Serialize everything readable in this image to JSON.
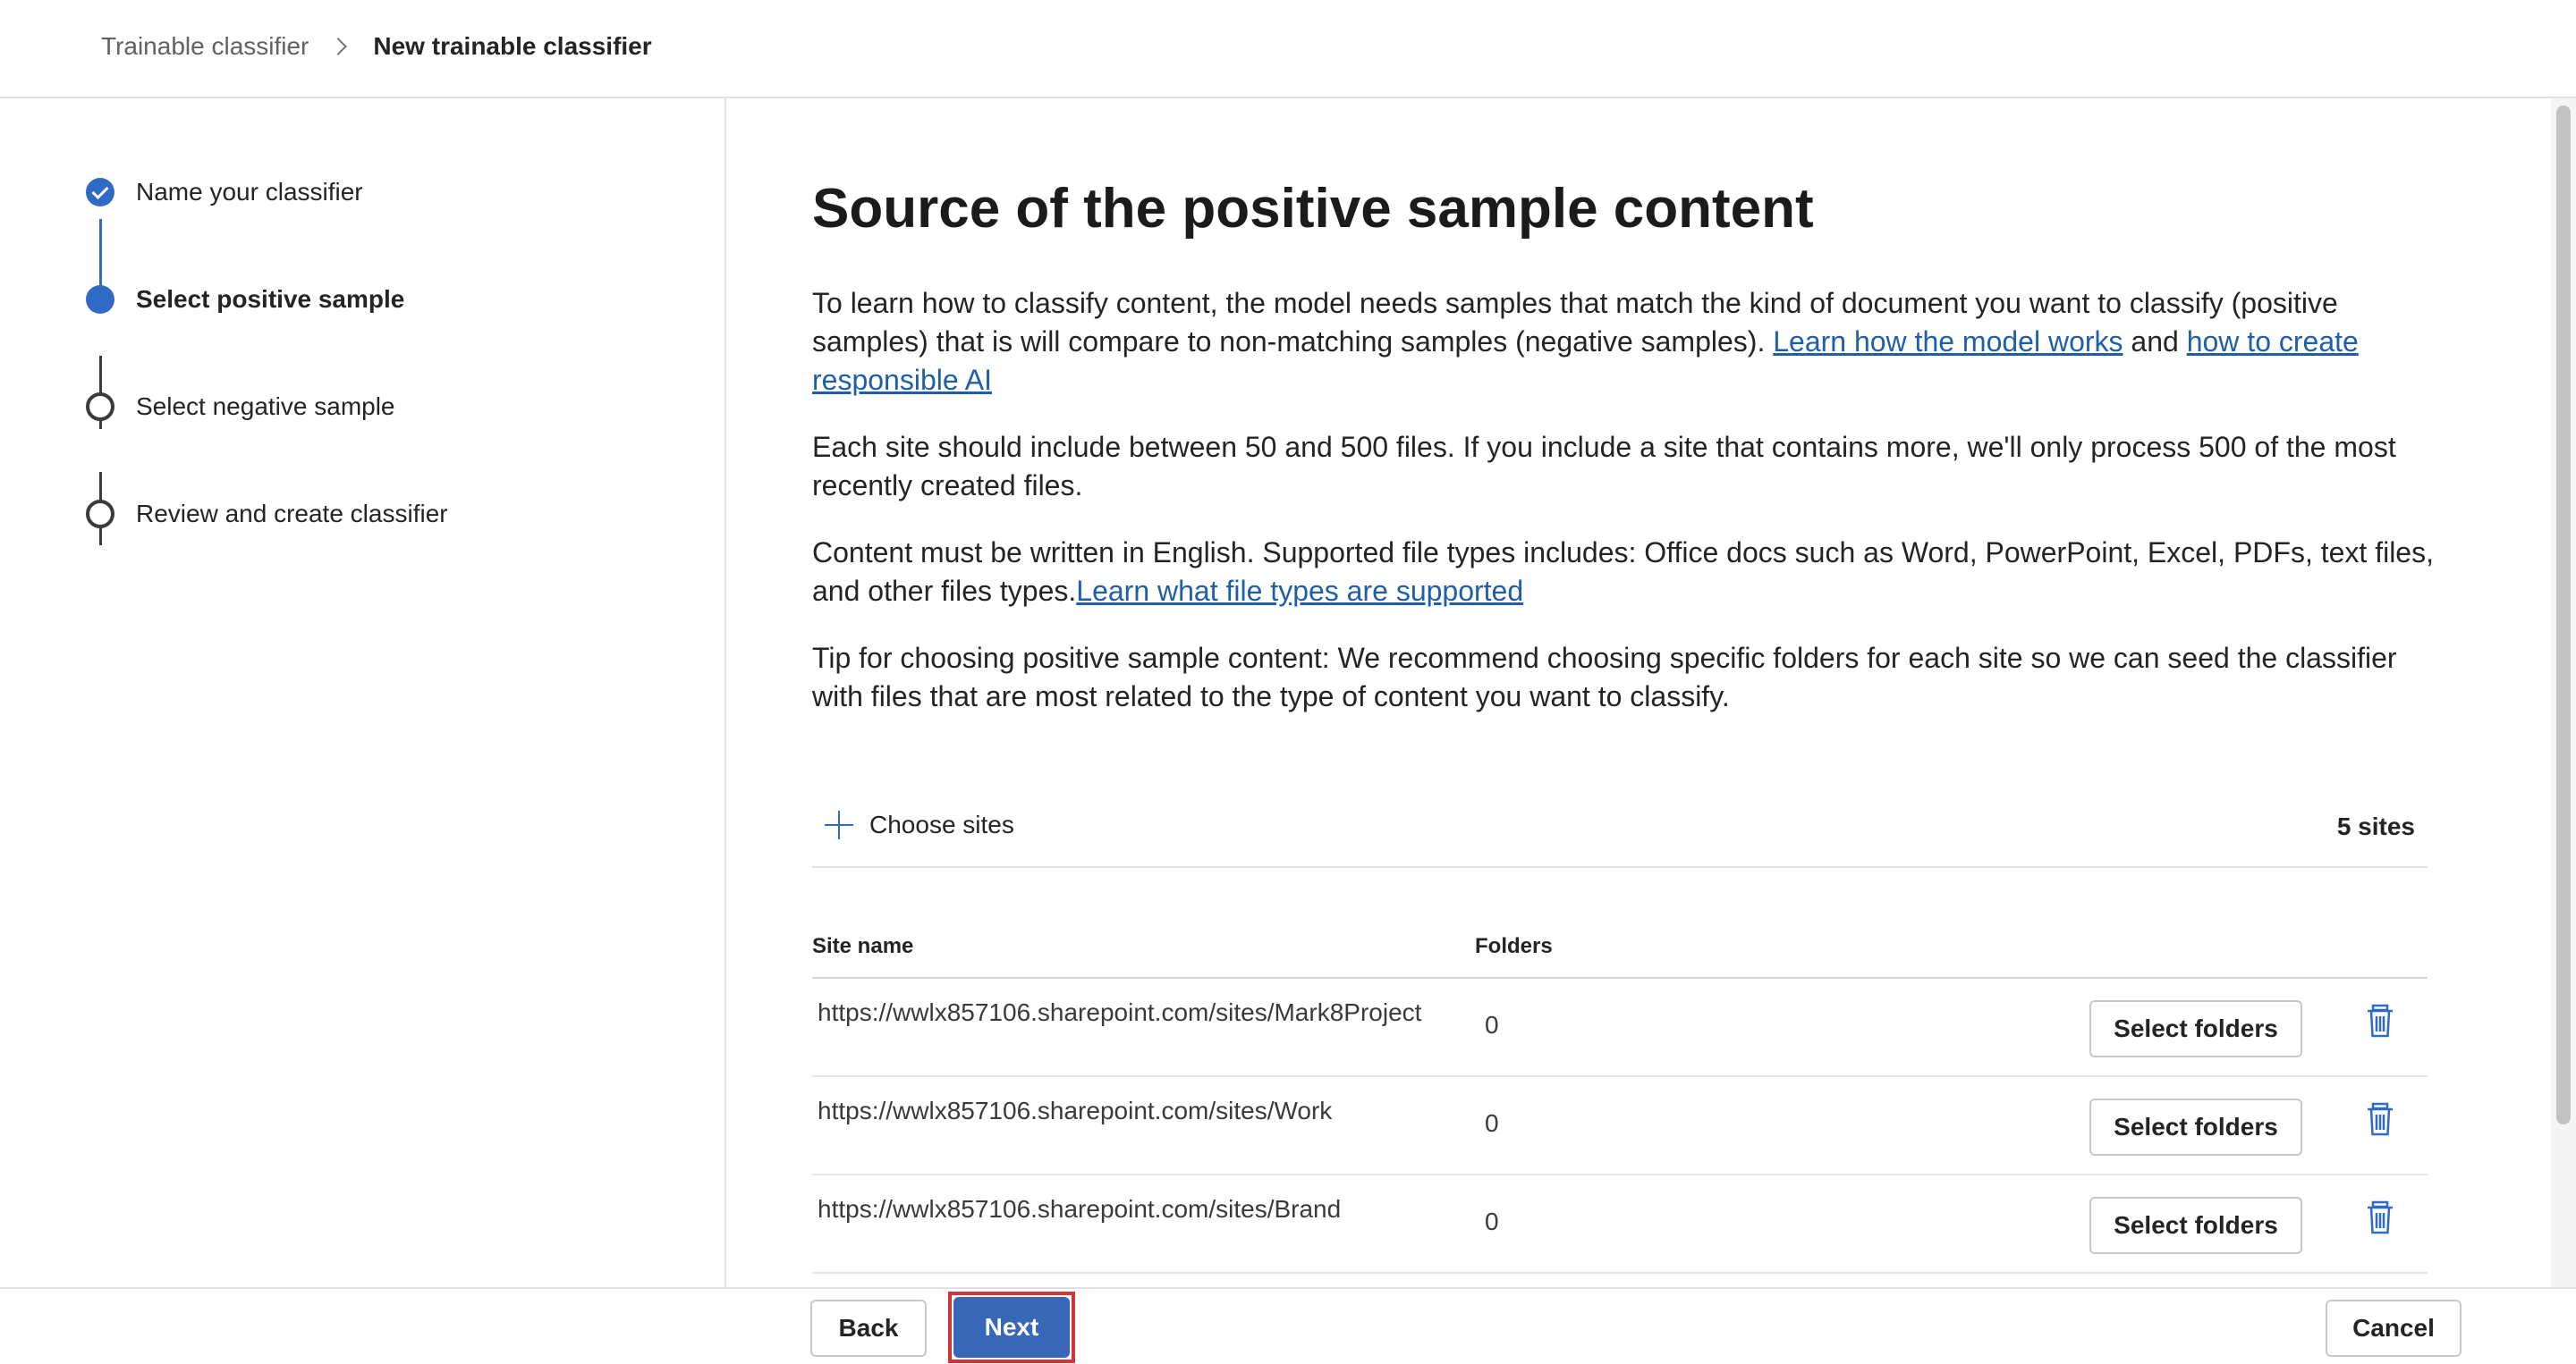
{
  "breadcrumb": {
    "root": "Trainable classifier",
    "current": "New trainable classifier"
  },
  "steps": [
    {
      "label": "Name your classifier",
      "status": "completed"
    },
    {
      "label": "Select positive sample",
      "status": "current"
    },
    {
      "label": "Select negative sample",
      "status": "pending"
    },
    {
      "label": "Review and create classifier",
      "status": "pending"
    }
  ],
  "main": {
    "title": "Source of the positive sample content",
    "para1": {
      "text": "To learn how to classify content, the model needs samples that match the kind of document you want to classify (positive samples) that is will compare to non-matching samples (negative samples). ",
      "link1": "Learn how the model works",
      "joiner": " and ",
      "link2": "how to create responsible AI"
    },
    "para2": "Each site should include between 50 and 500 files. If you include a site that contains more, we'll only process 500 of the most recently created files.",
    "para3": {
      "text": "Content must be written in English. Supported file types includes: Office docs such as Word, PowerPoint, Excel, PDFs, text files, and other files types.",
      "link": "Learn what file types are supported"
    },
    "para4": "Tip for choosing positive sample content: We recommend choosing specific folders for each site so we can seed the classifier with files that are most related to the type of content you want to classify.",
    "choose_sites_label": "Choose sites",
    "sites_count": "5 sites",
    "table": {
      "col_site": "Site name",
      "col_folders": "Folders",
      "select_label": "Select folders",
      "rows": [
        {
          "site": "https://wwlx857106.sharepoint.com/sites/Mark8Project",
          "folders": "0"
        },
        {
          "site": "https://wwlx857106.sharepoint.com/sites/Work",
          "folders": "0"
        },
        {
          "site": "https://wwlx857106.sharepoint.com/sites/Brand",
          "folders": "0"
        }
      ]
    }
  },
  "footer": {
    "back": "Back",
    "next": "Next",
    "cancel": "Cancel"
  },
  "colors": {
    "accent": "#2f6bc5",
    "primary_button": "#3867b8",
    "link": "#1f5fa8",
    "highlight": "#d13438"
  },
  "icons": {
    "check": "check-icon",
    "chevron": "chevron-right-icon",
    "add": "plus-icon",
    "delete": "trash-icon"
  }
}
